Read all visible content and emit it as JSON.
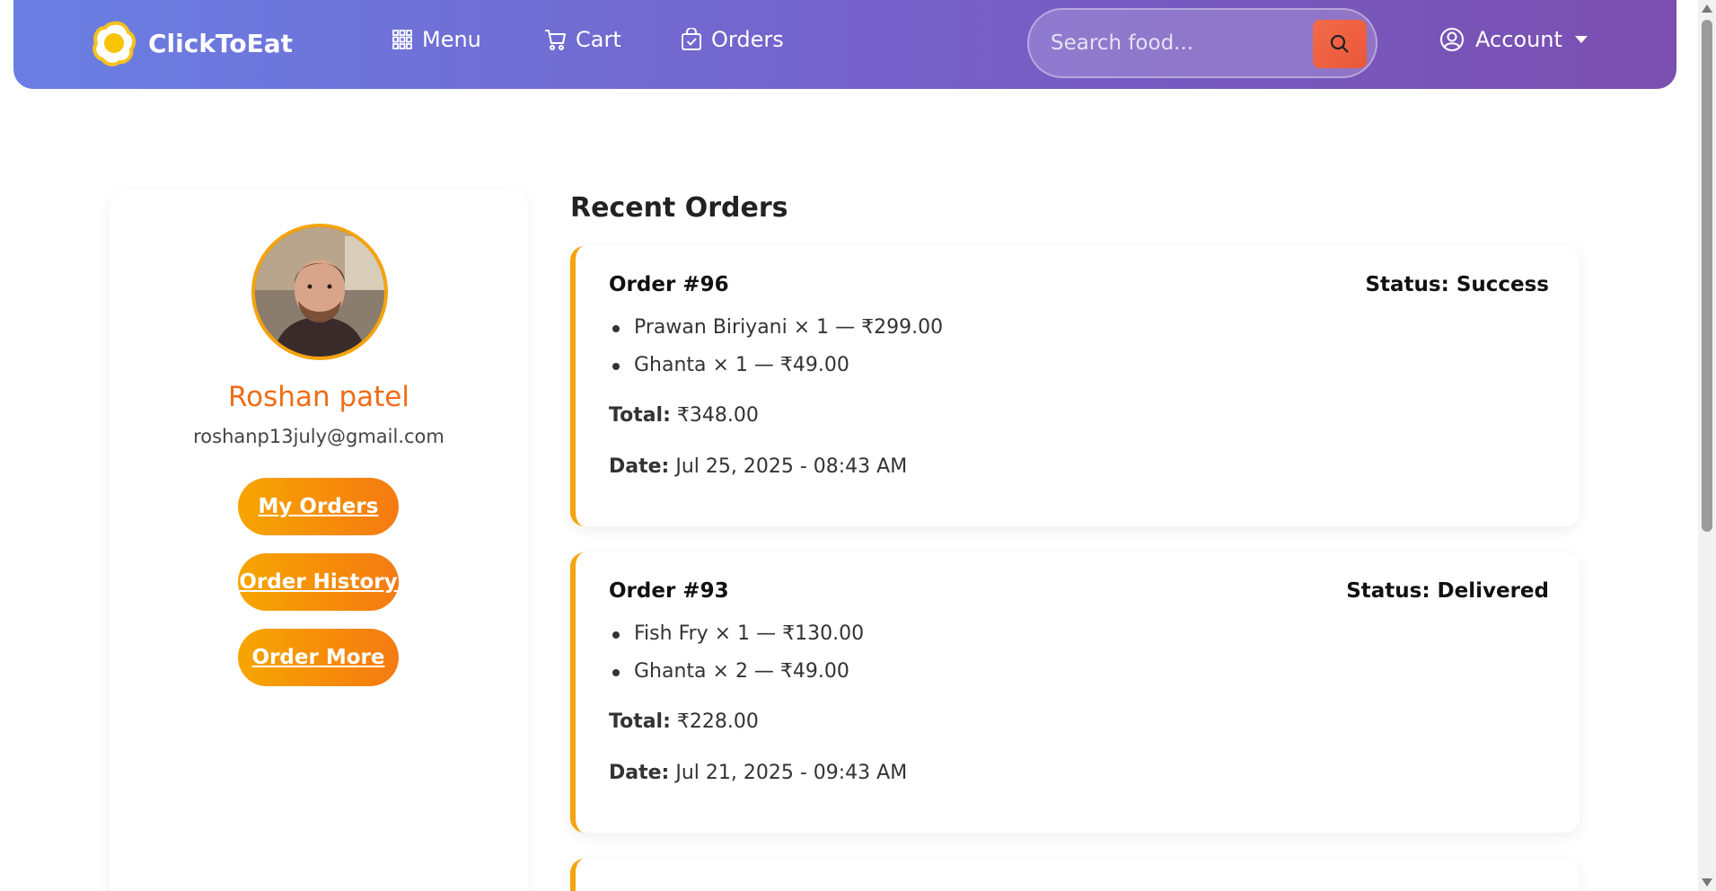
{
  "nav": {
    "brand": "ClickToEat",
    "links": [
      {
        "label": "Menu",
        "icon": "grid-icon"
      },
      {
        "label": "Cart",
        "icon": "cart-icon"
      },
      {
        "label": "Orders",
        "icon": "bag-check-icon"
      }
    ],
    "search_placeholder": "Search food...",
    "account_label": "Account"
  },
  "profile": {
    "name": "Roshan patel",
    "email": "roshanp13july@gmail.com",
    "buttons": [
      "My Orders",
      "Order History",
      "Order More"
    ]
  },
  "orders_section": {
    "title": "Recent Orders",
    "total_label": "Total:",
    "date_label": "Date:",
    "orders": [
      {
        "id": "Order #96",
        "status": "Status: Success",
        "items": [
          "Prawan Biriyani × 1 — ₹299.00",
          "Ghanta × 1 — ₹49.00"
        ],
        "total": "₹348.00",
        "date": "Jul 25, 2025 - 08:43 AM"
      },
      {
        "id": "Order #93",
        "status": "Status: Delivered",
        "items": [
          "Fish Fry × 1 — ₹130.00",
          "Ghanta × 2 — ₹49.00"
        ],
        "total": "₹228.00",
        "date": "Jul 21, 2025 - 09:43 AM"
      }
    ]
  },
  "colors": {
    "nav_gradient_start": "#6a7fe3",
    "nav_gradient_end": "#7a4fb0",
    "accent_orange": "#f57a12",
    "accent_yellow": "#f5a30e",
    "search_button": "#e9573a"
  }
}
